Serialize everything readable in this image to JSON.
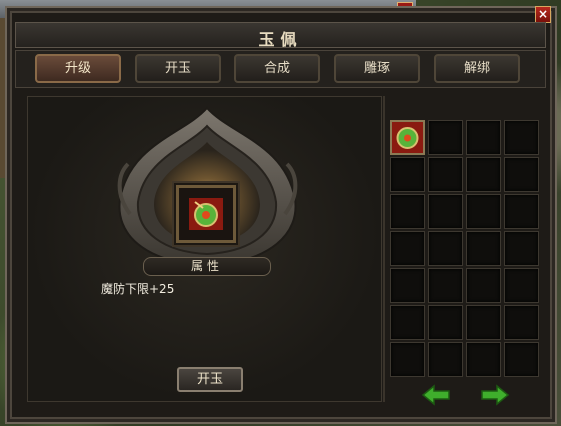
{
  "window": {
    "title": "玉佩",
    "close_glyph": "×"
  },
  "background_window": {
    "close_glyph": "×"
  },
  "tabs": [
    {
      "label": "升级",
      "active": true
    },
    {
      "label": "开玉",
      "active": false
    },
    {
      "label": "合成",
      "active": false
    },
    {
      "label": "雕琢",
      "active": false
    },
    {
      "label": "解绑",
      "active": false
    }
  ],
  "item": {
    "icon": "jade-pendant-icon"
  },
  "attributes": {
    "header": "属性",
    "lines": [
      "魔防下限+25"
    ]
  },
  "action_button": {
    "label": "开玉"
  },
  "inventory": {
    "columns": 4,
    "rows": 7,
    "filled_slots": [
      0
    ]
  },
  "colors": {
    "panel_bg": "#1e1b17",
    "accent_gold": "#8c7a55",
    "arrow_green": "#3fae2c"
  }
}
